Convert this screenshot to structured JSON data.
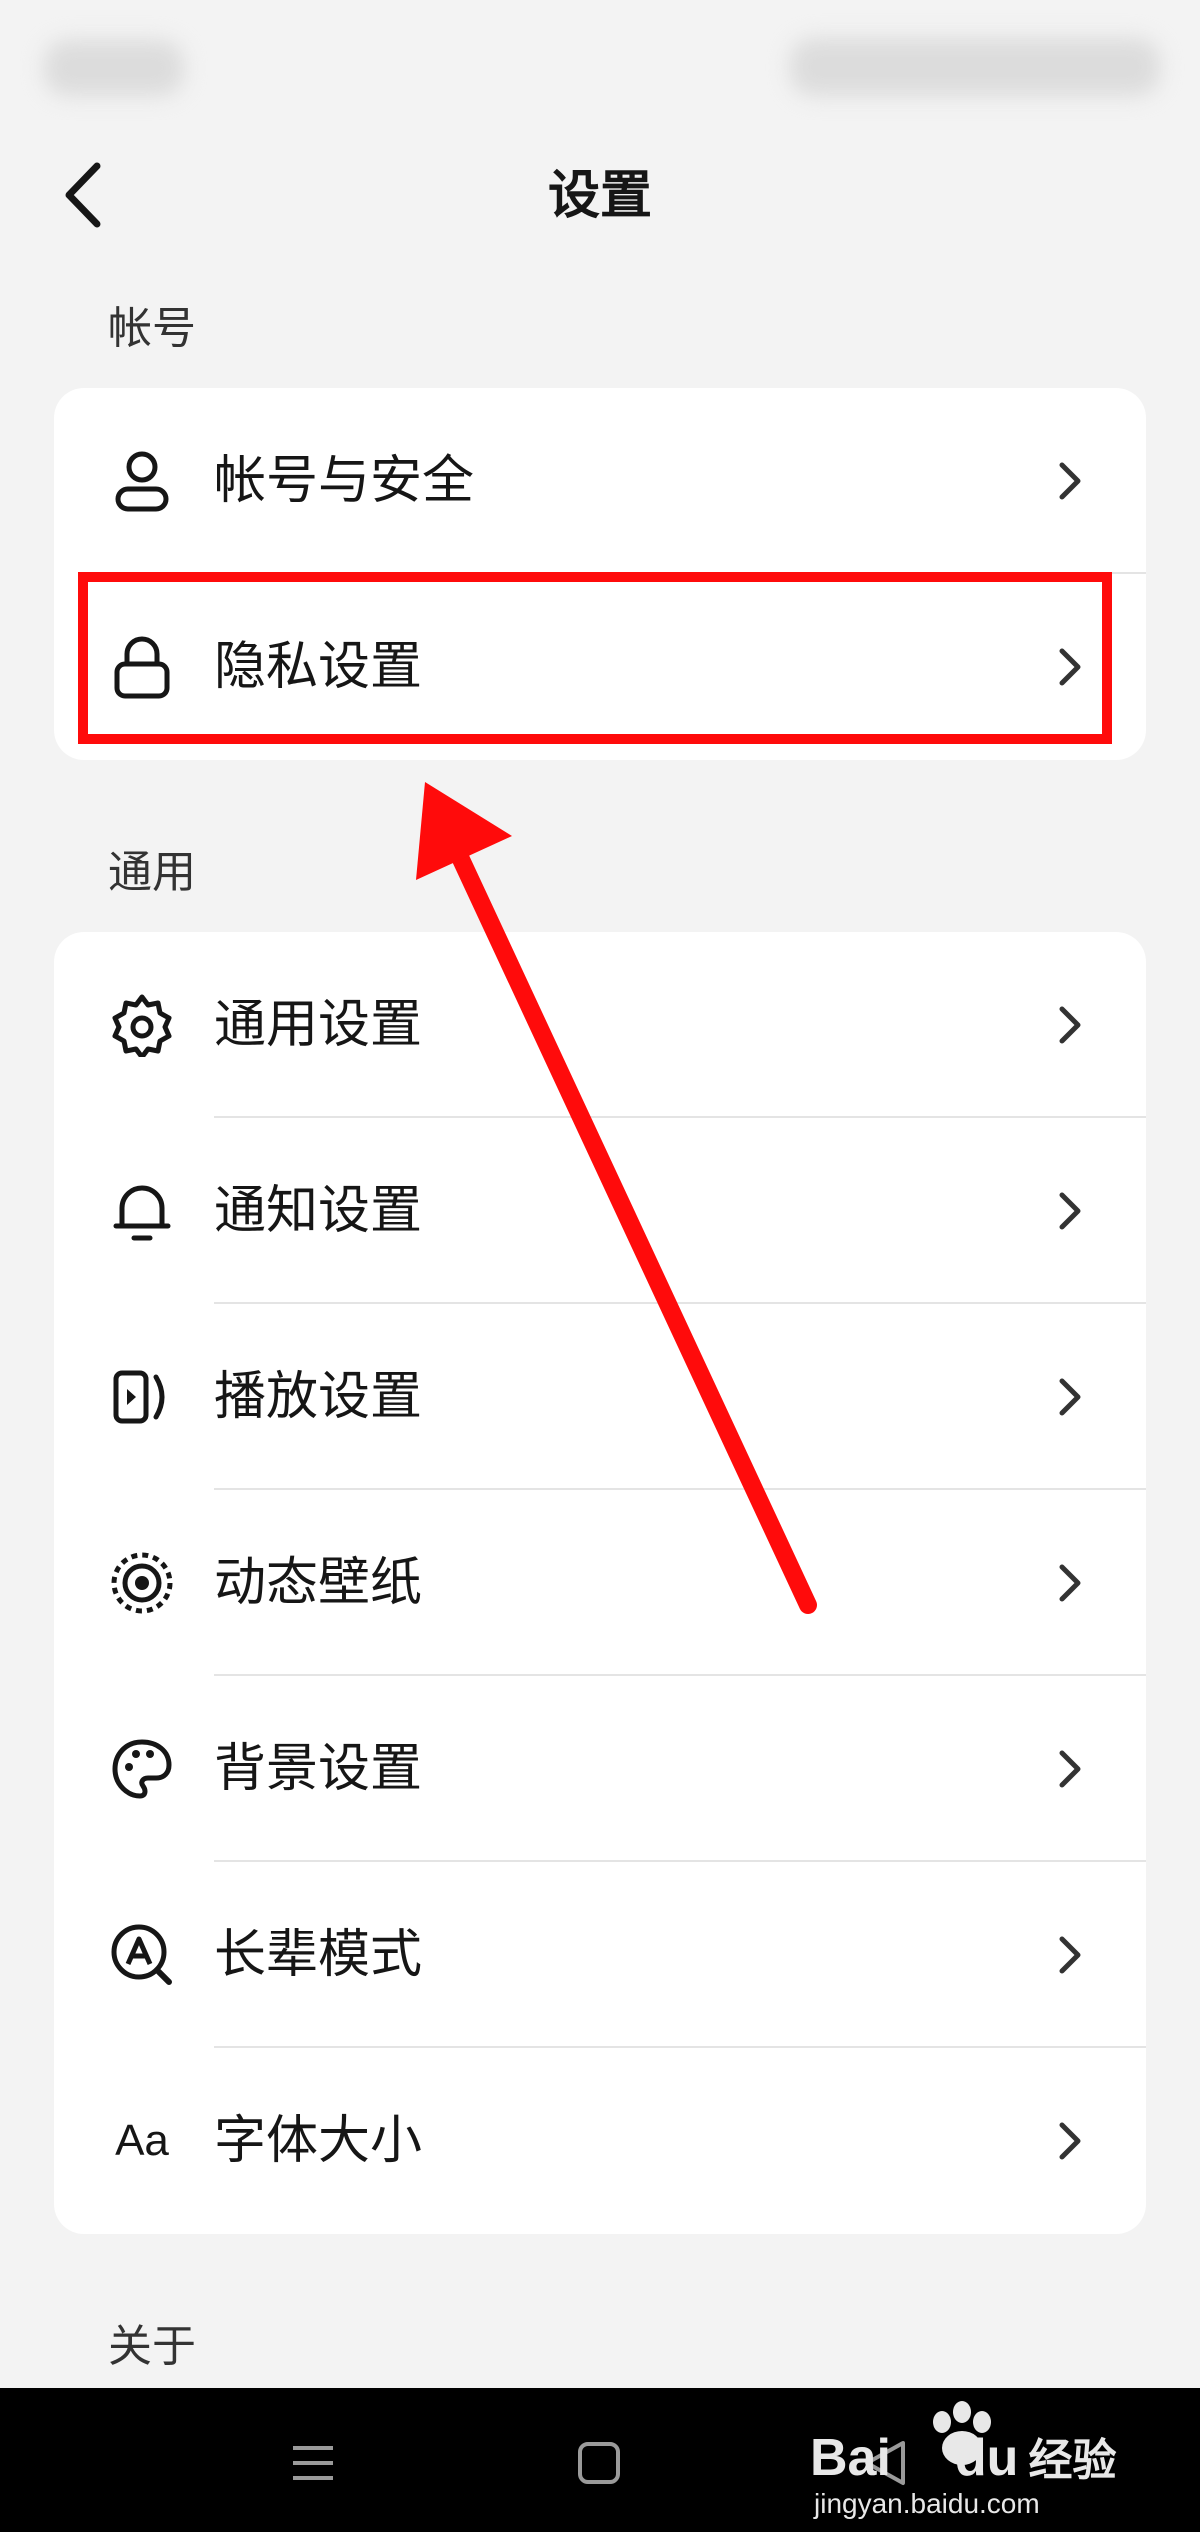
{
  "header": {
    "title": "设置"
  },
  "sections": {
    "account": {
      "label": "帐号",
      "items": [
        {
          "label": "帐号与安全",
          "icon": "user-icon"
        },
        {
          "label": "隐私设置",
          "icon": "lock-icon"
        }
      ]
    },
    "general": {
      "label": "通用",
      "items": [
        {
          "label": "通用设置",
          "icon": "gear-icon"
        },
        {
          "label": "通知设置",
          "icon": "bell-icon"
        },
        {
          "label": "播放设置",
          "icon": "play-screen-icon"
        },
        {
          "label": "动态壁纸",
          "icon": "dynamic-wallpaper-icon"
        },
        {
          "label": "背景设置",
          "icon": "palette-icon"
        },
        {
          "label": "长辈模式",
          "icon": "elder-mode-icon"
        },
        {
          "label": "字体大小",
          "icon": "font-size-icon",
          "icon_text": "Aa"
        }
      ]
    },
    "about": {
      "label": "关于"
    }
  },
  "annotation": {
    "color": "#ff0b0b",
    "highlighted_item": "隐私设置"
  },
  "watermark": {
    "brand": "Bai",
    "brand_suffix": "du",
    "tagline": "经验",
    "url": "jingyan.baidu.com"
  },
  "colors": {
    "background": "#f3f3f3",
    "card": "#ffffff",
    "text": "#161616",
    "nav_bar": "#000000"
  }
}
